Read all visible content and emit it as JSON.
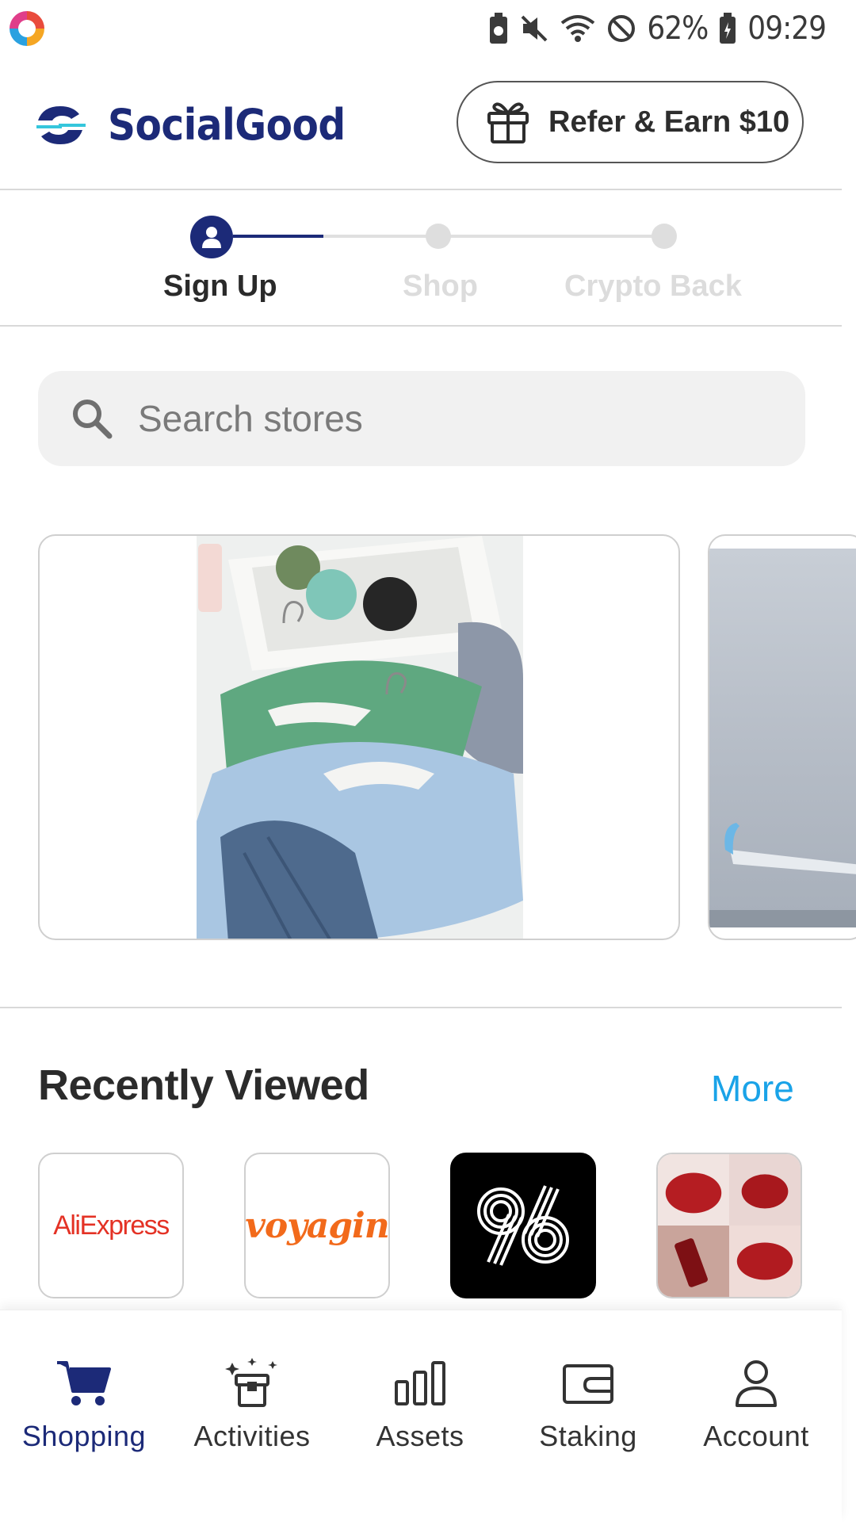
{
  "status_bar": {
    "battery": "62%",
    "time": "09:29"
  },
  "header": {
    "brand": "SocialGood",
    "refer_button": "Refer & Earn $10"
  },
  "stepper": {
    "steps": [
      {
        "label": "Sign Up",
        "state": "active"
      },
      {
        "label": "Shop",
        "state": "inactive"
      },
      {
        "label": "Crypto Back",
        "state": "inactive"
      }
    ]
  },
  "search": {
    "placeholder": "Search stores"
  },
  "carousel": {
    "banners": [
      {
        "image": "folded sweatshirts with hangers, jeans, backpack and cosmetics"
      },
      {
        "image": "airplane wing against a cloudy sky"
      }
    ]
  },
  "recently_viewed": {
    "title": "Recently Viewed",
    "more": "More",
    "stores": [
      {
        "logo_text": "AliExpress"
      },
      {
        "logo_text": "voyagin"
      },
      {
        "logo_text": "96"
      },
      {
        "logo_text": ""
      }
    ]
  },
  "bottom_nav": {
    "items": [
      {
        "label": "Shopping",
        "icon": "cart-icon",
        "active": true
      },
      {
        "label": "Activities",
        "icon": "gift-box-icon",
        "active": false
      },
      {
        "label": "Assets",
        "icon": "bar-chart-icon",
        "active": false
      },
      {
        "label": "Staking",
        "icon": "wallet-icon",
        "active": false
      },
      {
        "label": "Account",
        "icon": "person-icon",
        "active": false
      }
    ]
  },
  "colors": {
    "brand_navy": "#1c2a78",
    "link_blue": "#1aa3e8",
    "inactive_step": "#dcdcdc"
  }
}
